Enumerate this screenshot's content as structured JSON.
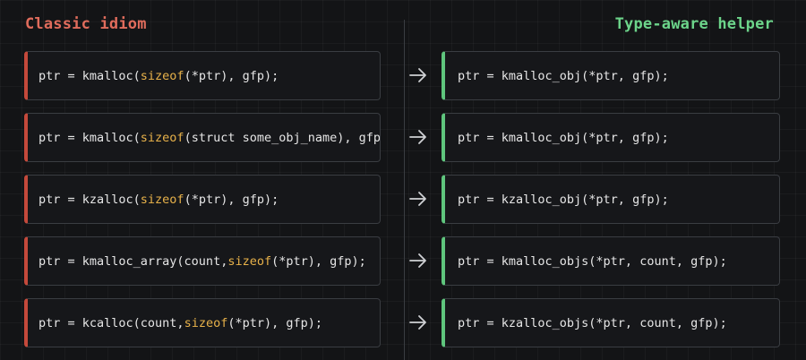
{
  "headings": {
    "left": "Classic idiom",
    "right": "Type-aware helper"
  },
  "colors": {
    "background": "#131416",
    "left_accent": "#c4493b",
    "left_heading": "#e06c5c",
    "right_accent": "#5fc57d",
    "right_heading": "#6cd48a",
    "keyword": "#e8b24a",
    "text": "#e6e6e6"
  },
  "rows": [
    {
      "left": {
        "pre": "ptr = kmalloc(",
        "kw": "sizeof",
        "post": "(*ptr), gfp);"
      },
      "right": "ptr = kmalloc_obj(*ptr, gfp);",
      "arrow_icon": "right-arrow"
    },
    {
      "left": {
        "pre": "ptr = kmalloc(",
        "kw": "sizeof",
        "post": "(struct some_obj_name), gfp);"
      },
      "right": "ptr = kmalloc_obj(*ptr, gfp);",
      "arrow_icon": "right-arrow"
    },
    {
      "left": {
        "pre": "ptr = kzalloc(",
        "kw": "sizeof",
        "post": "(*ptr), gfp);"
      },
      "right": "ptr = kzalloc_obj(*ptr, gfp);",
      "arrow_icon": "right-arrow"
    },
    {
      "left": {
        "pre": "ptr = kmalloc_array(count, ",
        "kw": "sizeof",
        "post": "(*ptr), gfp);"
      },
      "right": "ptr = kmalloc_objs(*ptr, count, gfp);",
      "arrow_icon": "right-arrow"
    },
    {
      "left": {
        "pre": "ptr = kcalloc(count, ",
        "kw": "sizeof",
        "post": "(*ptr), gfp);"
      },
      "right": "ptr = kzalloc_objs(*ptr, count, gfp);",
      "arrow_icon": "right-arrow"
    }
  ]
}
